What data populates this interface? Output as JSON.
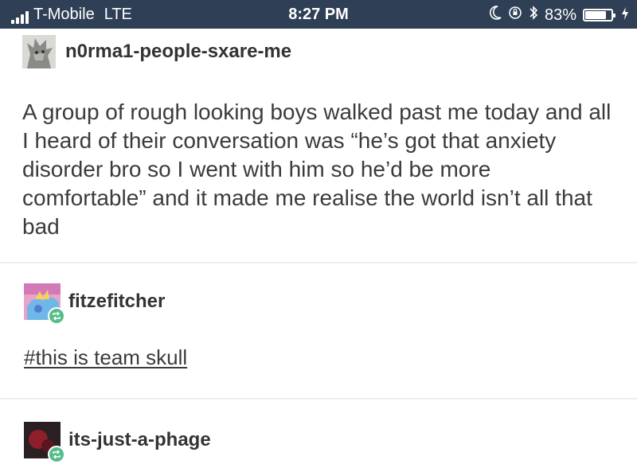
{
  "status_bar": {
    "carrier": "T-Mobile",
    "network": "LTE",
    "time": "8:27 PM",
    "battery": "83%",
    "battery_level": 0.83,
    "icons": [
      "signal-icon",
      "moon-icon",
      "lock-rotation-icon",
      "bluetooth-icon",
      "battery-icon",
      "charging-icon"
    ]
  },
  "post": {
    "username": "n0rma1-people-sxare-me",
    "body": "A group of rough looking boys walked past me today and all I heard of their conversation was “he’s got that anxiety disorder bro so I went with him so he’d be more comfortable” and it made me realise the world isn’t all that bad"
  },
  "reblogs": [
    {
      "username": "fitzefitcher",
      "text": "#this is team skull"
    },
    {
      "username": "its-just-a-phage"
    }
  ],
  "colors": {
    "status_bar_bg": "#2f3f55",
    "reblog_badge": "#56bc8a"
  }
}
